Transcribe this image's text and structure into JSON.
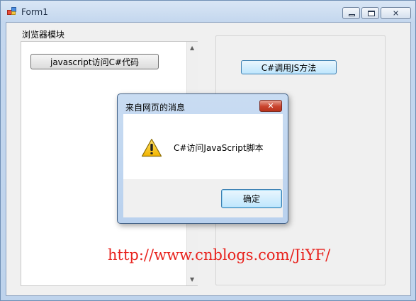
{
  "window": {
    "title": "Form1",
    "caption_buttons": {
      "minimize": "minimize-icon",
      "maximize": "maximize-icon",
      "close": "close-icon"
    }
  },
  "group": {
    "label": "浏览器模块"
  },
  "browser": {
    "js_button_label": "javascript访问C#代码"
  },
  "right": {
    "cs_button_label": "C#调用JS方法"
  },
  "dialog": {
    "title": "来自网页的消息",
    "message": "C#访问JavaScript脚本",
    "icon": "warning-icon",
    "ok_label": "确定",
    "close_glyph": "✕"
  },
  "watermark": {
    "text": "http://www.cnblogs.com/JiYF/",
    "color": "#e8231e"
  }
}
